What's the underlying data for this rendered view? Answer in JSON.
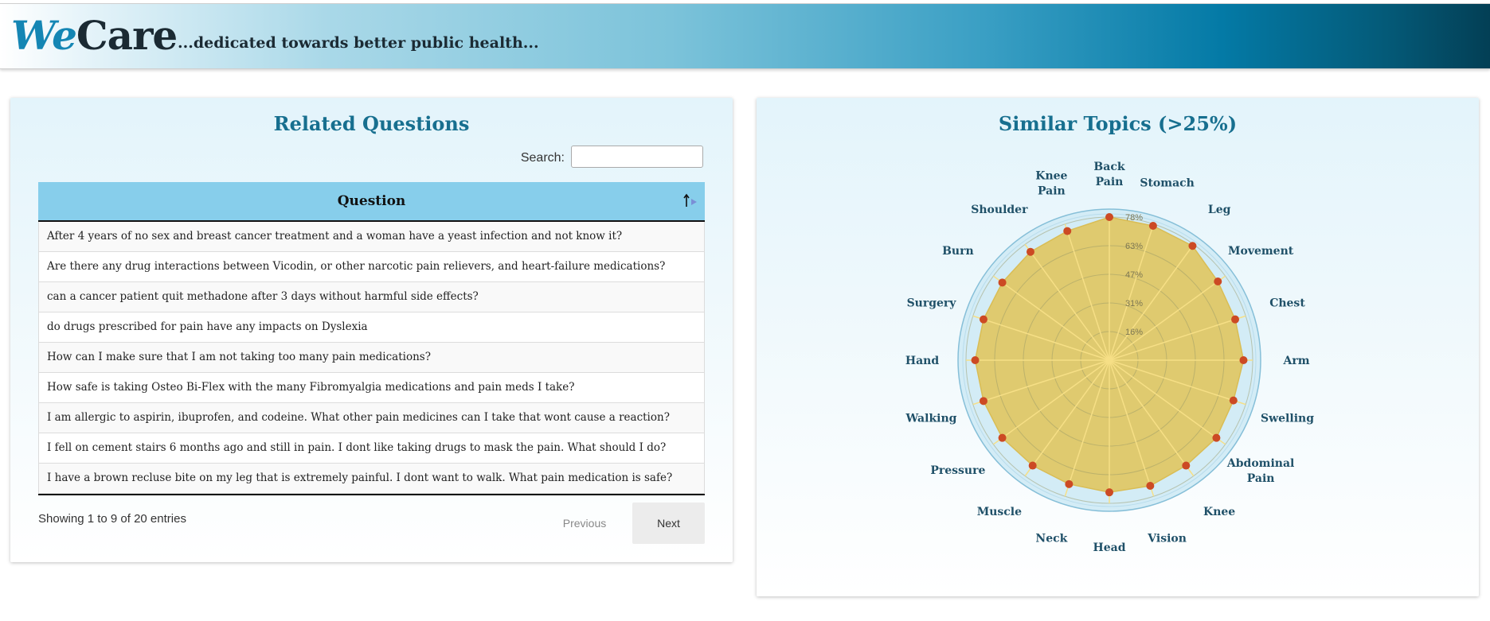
{
  "header": {
    "logo_we": "We",
    "logo_care": "Care",
    "tagline": "...dedicated towards better public health..."
  },
  "questions_panel": {
    "title": "Related Questions",
    "search_label": "Search:",
    "search_value": "",
    "column_header": "Question",
    "rows": [
      "After 4 years of no sex and breast cancer treatment and a woman have a yeast infection and not know it?",
      "Are there any drug interactions between Vicodin, or other narcotic pain relievers, and heart-failure medications?",
      "can a cancer patient quit methadone after 3 days without harmful side effects?",
      "do drugs prescribed for pain have any impacts on Dyslexia",
      "How can I make sure that I am not taking too many pain medications?",
      "How safe is taking Osteo Bi-Flex with the many Fibromyalgia medications and pain meds I take?",
      "I am allergic to aspirin, ibuprofen, and codeine. What other pain medicines can I take that wont cause a reaction?",
      "I fell on cement stairs 6 months ago and still in pain. I dont like taking drugs to mask the pain. What should I do?",
      "I have a brown recluse bite on my leg that is extremely painful. I dont want to walk. What pain medication is safe?"
    ],
    "info": "Showing 1 to 9 of 20 entries",
    "prev_label": "Previous",
    "next_label": "Next"
  },
  "topics_panel": {
    "title": "Similar Topics (>25%)"
  },
  "colors": {
    "accent": "#176f8f",
    "table_header": "#87ceeb",
    "radar_fill": "#dfc763",
    "radar_point": "#cc4a24"
  },
  "chart_data": {
    "type": "radar",
    "max": 78,
    "tick_labels": [
      "16%",
      "31%",
      "47%",
      "63%",
      "78%"
    ],
    "categories": [
      [
        "Back",
        "Pain"
      ],
      [
        "Stomach"
      ],
      [
        "Leg"
      ],
      [
        "Movement"
      ],
      [
        "Chest"
      ],
      [
        "Arm"
      ],
      [
        "Swelling"
      ],
      [
        "Abdominal",
        "Pain"
      ],
      [
        "Knee"
      ],
      [
        "Vision"
      ],
      [
        "Head"
      ],
      [
        "Neck"
      ],
      [
        "Muscle"
      ],
      [
        "Pressure"
      ],
      [
        "Walking"
      ],
      [
        "Hand"
      ],
      [
        "Surgery"
      ],
      [
        "Burn"
      ],
      [
        "Shoulder"
      ],
      [
        "Knee",
        "Pain"
      ]
    ],
    "values": [
      78,
      77,
      77,
      73,
      72,
      73,
      71,
      72,
      71,
      72,
      72,
      71,
      71,
      72,
      72,
      73,
      72,
      72,
      73,
      74
    ]
  }
}
